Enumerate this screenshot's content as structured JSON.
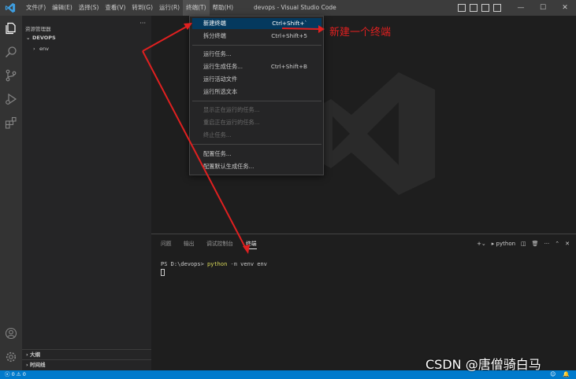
{
  "menu": {
    "items": [
      "文件(F)",
      "编辑(E)",
      "选择(S)",
      "查看(V)",
      "转到(G)",
      "运行(R)",
      "终端(T)",
      "帮助(H)"
    ]
  },
  "window": {
    "title": "devops - Visual Studio Code",
    "controls": [
      "—",
      "☐",
      "✕"
    ]
  },
  "sidebar": {
    "title": "资源管理器",
    "more": "···",
    "folder": "DEVOPS",
    "items": [
      "env"
    ],
    "bottom": [
      "大纲",
      "时间线"
    ]
  },
  "dropdown": {
    "items": [
      {
        "label": "新建终端",
        "shortcut": "Ctrl+Shift+`"
      },
      {
        "label": "拆分终端",
        "shortcut": "Ctrl+Shift+5"
      },
      {
        "label": "运行任务..."
      },
      {
        "label": "运行生成任务...",
        "shortcut": "Ctrl+Shift+B"
      },
      {
        "label": "运行活动文件"
      },
      {
        "label": "运行所选文本"
      },
      {
        "label": "显示正在运行的任务..."
      },
      {
        "label": "重启正在运行的任务..."
      },
      {
        "label": "终止任务..."
      },
      {
        "label": "配置任务..."
      },
      {
        "label": "配置默认生成任务..."
      }
    ]
  },
  "annotation": "新建一个终端",
  "panel": {
    "tabs": [
      "问题",
      "输出",
      "调试控制台",
      "终端"
    ],
    "active_tab": "终端",
    "terminal_name": "python",
    "prompt": "PS D:\\devops> ",
    "command": "python",
    "flag": " -m",
    "args": " venv env"
  },
  "status": {
    "errors": "0",
    "warnings": "0"
  },
  "watermark": "CSDN @唐僧骑白马",
  "colors": {
    "accent": "#007acc",
    "menu_selected": "#04395e",
    "annotation": "#e02020",
    "command": "#dcdc5a"
  }
}
